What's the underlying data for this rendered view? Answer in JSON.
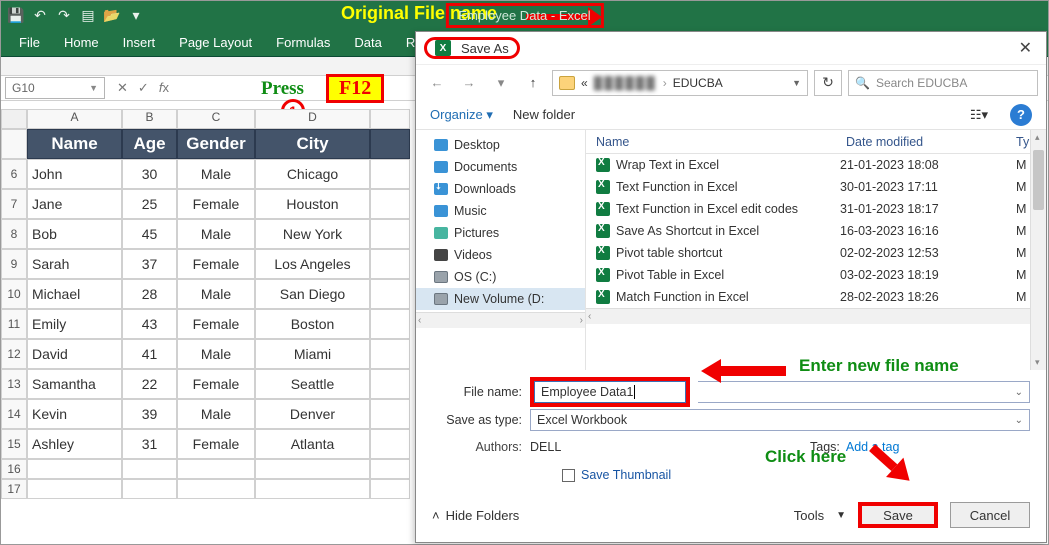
{
  "titlebar": {
    "app_title": "Employee Data  -  Excel",
    "annotate": "Original File name"
  },
  "ribbon": {
    "tabs": [
      "File",
      "Home",
      "Insert",
      "Page Layout",
      "Formulas",
      "Data",
      "R"
    ]
  },
  "formula_bar": {
    "namebox": "G10",
    "press_label": "Press",
    "key_label": "F12"
  },
  "sheet": {
    "columns": [
      "A",
      "B",
      "C",
      "D"
    ],
    "headers": {
      "A": "Name",
      "B": "Age",
      "C": "Gender",
      "D": "City"
    },
    "rows": [
      {
        "n": "6",
        "A": "John",
        "B": "30",
        "C": "Male",
        "D": "Chicago"
      },
      {
        "n": "7",
        "A": "Jane",
        "B": "25",
        "C": "Female",
        "D": "Houston"
      },
      {
        "n": "8",
        "A": "Bob",
        "B": "45",
        "C": "Male",
        "D": "New York"
      },
      {
        "n": "9",
        "A": "Sarah",
        "B": "37",
        "C": "Female",
        "D": "Los Angeles"
      },
      {
        "n": "10",
        "A": "Michael",
        "B": "28",
        "C": "Male",
        "D": "San Diego"
      },
      {
        "n": "11",
        "A": "Emily",
        "B": "43",
        "C": "Female",
        "D": "Boston"
      },
      {
        "n": "12",
        "A": "David",
        "B": "41",
        "C": "Male",
        "D": "Miami"
      },
      {
        "n": "13",
        "A": "Samantha",
        "B": "22",
        "C": "Female",
        "D": "Seattle"
      },
      {
        "n": "14",
        "A": "Kevin",
        "B": "39",
        "C": "Male",
        "D": "Denver"
      },
      {
        "n": "15",
        "A": "Ashley",
        "B": "31",
        "C": "Female",
        "D": "Atlanta"
      }
    ],
    "trailing_rows": [
      "16",
      "17"
    ]
  },
  "dialog": {
    "title": "Save As",
    "breadcrumb": {
      "blur": "██████",
      "folder": "EDUCBA"
    },
    "search_placeholder": "Search EDUCBA",
    "toolbar": {
      "organize": "Organize ▾",
      "newfolder": "New folder"
    },
    "tree": [
      {
        "icon": "desktop",
        "label": "Desktop"
      },
      {
        "icon": "doc",
        "label": "Documents"
      },
      {
        "icon": "down",
        "label": "Downloads"
      },
      {
        "icon": "music",
        "label": "Music"
      },
      {
        "icon": "pic",
        "label": "Pictures"
      },
      {
        "icon": "vid",
        "label": "Videos"
      },
      {
        "icon": "drive",
        "label": "OS (C:)"
      },
      {
        "icon": "drive",
        "label": "New Volume (D:",
        "sel": true
      }
    ],
    "list_cols": {
      "name": "Name",
      "date": "Date modified",
      "type": "Ty"
    },
    "files": [
      {
        "name": "Wrap Text in Excel",
        "date": "21-01-2023 18:08",
        "t": "M"
      },
      {
        "name": "Text Function in Excel",
        "date": "30-01-2023 17:11",
        "t": "M"
      },
      {
        "name": "Text Function in Excel edit codes",
        "date": "31-01-2023 18:17",
        "t": "M"
      },
      {
        "name": "Save As Shortcut in Excel",
        "date": "16-03-2023 16:16",
        "t": "M"
      },
      {
        "name": "Pivot table shortcut",
        "date": "02-02-2023 12:53",
        "t": "M"
      },
      {
        "name": "Pivot Table in Excel",
        "date": "03-02-2023 18:19",
        "t": "M"
      },
      {
        "name": "Match Function in Excel",
        "date": "28-02-2023 18:26",
        "t": "M"
      }
    ],
    "form": {
      "filename_label": "File name:",
      "filename_value": "Employee Data1",
      "savetype_label": "Save as type:",
      "savetype_value": "Excel Workbook",
      "authors_label": "Authors:",
      "authors_value": "DELL",
      "tags_label": "Tags:",
      "tags_value": "Add a tag",
      "thumb_label": "Save Thumbnail",
      "hide_folders": "Hide Folders",
      "tools": "Tools",
      "save": "Save",
      "cancel": "Cancel"
    },
    "annotate": {
      "fn": "Enter new file name",
      "save": "Click here"
    }
  }
}
